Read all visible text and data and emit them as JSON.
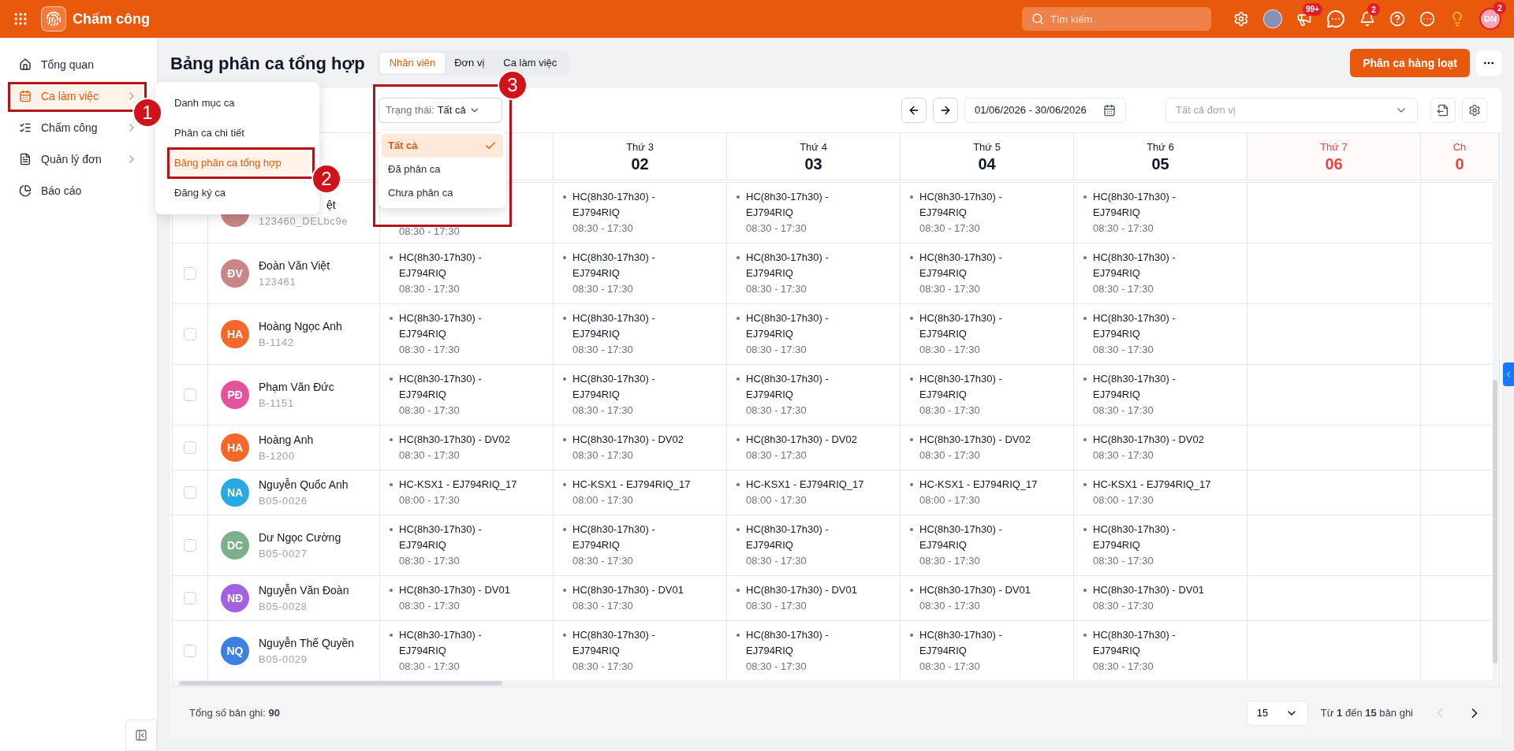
{
  "topbar": {
    "app_title": "Chấm công",
    "search": {
      "placeholder": "Tìm kiếm"
    },
    "announce_badge": "99+",
    "notification_badge": "2",
    "user": {
      "initials": "ĐN",
      "badge": "2"
    }
  },
  "sidebar": {
    "items": [
      {
        "label": "Tổng quan",
        "selected": false,
        "has_children": false
      },
      {
        "label": "Ca làm việc",
        "selected": true,
        "has_children": true
      },
      {
        "label": "Chấm công",
        "selected": false,
        "has_children": true
      },
      {
        "label": "Quản lý đơn",
        "selected": false,
        "has_children": true
      },
      {
        "label": "Báo cáo",
        "selected": false,
        "has_children": false
      }
    ],
    "submenu": [
      {
        "label": "Danh mục ca",
        "selected": false
      },
      {
        "label": "Phân ca chi tiết",
        "selected": false
      },
      {
        "label": "Bảng phân ca tổng hợp",
        "selected": true
      },
      {
        "label": "Đăng ký ca",
        "selected": false
      }
    ]
  },
  "page": {
    "title": "Bảng phân ca tổng hợp",
    "tabs": [
      {
        "label": "Nhân viên",
        "selected": true
      },
      {
        "label": "Đơn vị",
        "selected": false
      },
      {
        "label": "Ca làm việc",
        "selected": false
      }
    ],
    "primary_button": "Phân ca hàng loạt"
  },
  "filters": {
    "status": {
      "label": "Trạng thái:",
      "value": "Tất cả",
      "options": [
        {
          "label": "Tất cả",
          "selected": true
        },
        {
          "label": "Đã phân ca",
          "selected": false
        },
        {
          "label": "Chưa phân ca",
          "selected": false
        }
      ]
    },
    "date_range": "01/06/2026 - 30/06/2026",
    "unit": {
      "placeholder": "Tất cả đơn vị"
    }
  },
  "days": [
    {
      "weekday": "Thứ 3",
      "date": "02",
      "weekend": false
    },
    {
      "weekday": "Thứ 4",
      "date": "03",
      "weekend": false
    },
    {
      "weekday": "Thứ 5",
      "date": "04",
      "weekend": false
    },
    {
      "weekday": "Thứ 6",
      "date": "05",
      "weekend": false
    },
    {
      "weekday": "Thứ 7",
      "date": "06",
      "weekend": true
    },
    {
      "weekday": "Ch",
      "date": "0",
      "weekend": true
    }
  ],
  "rows": [
    {
      "color": "#c98686",
      "name": "ệt",
      "clipped": true,
      "code": "123460_DELbc9e",
      "shifts": [
        {
          "time": "08:30 - 17:30"
        },
        {
          "label": "HC(8h30-17h30) - EJ794RIQ",
          "time": "08:30 - 17:30"
        },
        {
          "label": "HC(8h30-17h30) - EJ794RIQ",
          "time": "08:30 - 17:30"
        },
        {
          "label": "HC(8h30-17h30) - EJ794RIQ",
          "time": "08:30 - 17:30"
        },
        {
          "label": "HC(8h30-17h30) - EJ794RIQ",
          "time": "08:30 - 17:30"
        }
      ]
    },
    {
      "initials": "ĐV",
      "color": "#c98686",
      "name": "Đoàn Văn Việt",
      "clipped": false,
      "code": "123461",
      "checked": false,
      "shifts": [
        {
          "label": "HC(8h30-17h30) - EJ794RIQ",
          "time": "08:30 - 17:30"
        },
        {
          "label": "HC(8h30-17h30) - EJ794RIQ",
          "time": "08:30 - 17:30"
        },
        {
          "label": "HC(8h30-17h30) - EJ794RIQ",
          "time": "08:30 - 17:30"
        },
        {
          "label": "HC(8h30-17h30) - EJ794RIQ",
          "time": "08:30 - 17:30"
        },
        {
          "label": "HC(8h30-17h30) - EJ794RIQ",
          "time": "08:30 - 17:30"
        }
      ]
    },
    {
      "initials": "HA",
      "color": "#f4692a",
      "name": "Hoàng Ngọc Anh",
      "clipped": false,
      "code": "B-1142",
      "checked": false,
      "shifts": [
        {
          "label": "HC(8h30-17h30) - EJ794RIQ",
          "time": "08:30 - 17:30"
        },
        {
          "label": "HC(8h30-17h30) - EJ794RIQ",
          "time": "08:30 - 17:30"
        },
        {
          "label": "HC(8h30-17h30) - EJ794RIQ",
          "time": "08:30 - 17:30"
        },
        {
          "label": "HC(8h30-17h30) - EJ794RIQ",
          "time": "08:30 - 17:30"
        },
        {
          "label": "HC(8h30-17h30) - EJ794RIQ",
          "time": "08:30 - 17:30"
        }
      ]
    },
    {
      "initials": "PĐ",
      "color": "#e5529b",
      "name": "Phạm Văn Đức",
      "clipped": false,
      "code": "B-1151",
      "checked": false,
      "shifts": [
        {
          "label": "HC(8h30-17h30) - EJ794RIQ",
          "time": "08:30 - 17:30"
        },
        {
          "label": "HC(8h30-17h30) - EJ794RIQ",
          "time": "08:30 - 17:30"
        },
        {
          "label": "HC(8h30-17h30) - EJ794RIQ",
          "time": "08:30 - 17:30"
        },
        {
          "label": "HC(8h30-17h30) - EJ794RIQ",
          "time": "08:30 - 17:30"
        },
        {
          "label": "HC(8h30-17h30) - EJ794RIQ",
          "time": "08:30 - 17:30"
        }
      ]
    },
    {
      "initials": "HA",
      "color": "#f4692a",
      "name": "Hoàng Anh",
      "clipped": false,
      "code": "B-1200",
      "checked": false,
      "shifts": [
        {
          "label": "HC(8h30-17h30) - DV02",
          "time": "08:30 - 17:30"
        },
        {
          "label": "HC(8h30-17h30) - DV02",
          "time": "08:30 - 17:30"
        },
        {
          "label": "HC(8h30-17h30) - DV02",
          "time": "08:30 - 17:30"
        },
        {
          "label": "HC(8h30-17h30) - DV02",
          "time": "08:30 - 17:30"
        },
        {
          "label": "HC(8h30-17h30) - DV02",
          "time": "08:30 - 17:30"
        }
      ]
    },
    {
      "initials": "NA",
      "color": "#27a9e1",
      "name": "Nguyễn Quốc Anh",
      "clipped": false,
      "code": "B05-0026",
      "checked": false,
      "shifts": [
        {
          "label": "HC-KSX1 - EJ794RIQ_17",
          "time": "08:00 - 17:30"
        },
        {
          "label": "HC-KSX1 - EJ794RIQ_17",
          "time": "08:00 - 17:30"
        },
        {
          "label": "HC-KSX1 - EJ794RIQ_17",
          "time": "08:00 - 17:30"
        },
        {
          "label": "HC-KSX1 - EJ794RIQ_17",
          "time": "08:00 - 17:30"
        },
        {
          "label": "HC-KSX1 - EJ794RIQ_17",
          "time": "08:00 - 17:30"
        }
      ]
    },
    {
      "initials": "DC",
      "color": "#7daf8c",
      "name": "Dư Ngọc Cường",
      "clipped": false,
      "code": "B05-0027",
      "checked": false,
      "shifts": [
        {
          "label": "HC(8h30-17h30) - EJ794RIQ",
          "time": "08:30 - 17:30"
        },
        {
          "label": "HC(8h30-17h30) - EJ794RIQ",
          "time": "08:30 - 17:30"
        },
        {
          "label": "HC(8h30-17h30) - EJ794RIQ",
          "time": "08:30 - 17:30"
        },
        {
          "label": "HC(8h30-17h30) - EJ794RIQ",
          "time": "08:30 - 17:30"
        },
        {
          "label": "HC(8h30-17h30) - EJ794RIQ",
          "time": "08:30 - 17:30"
        }
      ]
    },
    {
      "initials": "NĐ",
      "color": "#a262e0",
      "name": "Nguyễn Văn Đoàn",
      "clipped": false,
      "code": "B05-0028",
      "checked": false,
      "shifts": [
        {
          "label": "HC(8h30-17h30) - DV01",
          "time": "08:30 - 17:30"
        },
        {
          "label": "HC(8h30-17h30) - DV01",
          "time": "08:30 - 17:30"
        },
        {
          "label": "HC(8h30-17h30) - DV01",
          "time": "08:30 - 17:30"
        },
        {
          "label": "HC(8h30-17h30) - DV01",
          "time": "08:30 - 17:30"
        },
        {
          "label": "HC(8h30-17h30) - DV01",
          "time": "08:30 - 17:30"
        }
      ]
    },
    {
      "initials": "NQ",
      "color": "#3b82e0",
      "name": "Nguyễn Thế Quyền",
      "clipped": false,
      "code": "B05-0029",
      "checked": false,
      "shifts": [
        {
          "label": "HC(8h30-17h30) - EJ794RIQ",
          "time": "08:30 - 17:30"
        },
        {
          "label": "HC(8h30-17h30) - EJ794RIQ",
          "time": "08:30 - 17:30"
        },
        {
          "label": "HC(8h30-17h30) - EJ794RIQ",
          "time": "08:30 - 17:30"
        },
        {
          "label": "HC(8h30-17h30) - EJ794RIQ",
          "time": "08:30 - 17:30"
        },
        {
          "label": "HC(8h30-17h30) - EJ794RIQ",
          "time": "08:30 - 17:30"
        }
      ]
    }
  ],
  "footer": {
    "total": "Tổng số bản ghi: **90**",
    "page_size": "15",
    "range": "Từ **1** đến **15** bản ghi",
    "prev_disabled": true
  },
  "annotations": [
    {
      "label": "1"
    },
    {
      "label": "2"
    },
    {
      "label": "3"
    }
  ]
}
